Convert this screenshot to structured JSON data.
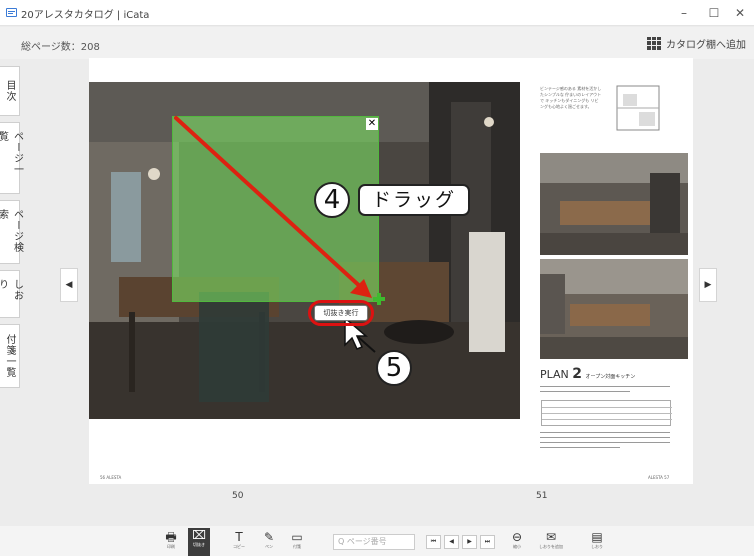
{
  "window": {
    "title": "20アレスタカタログ | iCata",
    "minimize": "–",
    "maximize": "☐",
    "close": "✕"
  },
  "header": {
    "page_count": "総ページ数：208",
    "add_catalog": "カタログ棚へ追加"
  },
  "sidebar": {
    "tabs": [
      "目次",
      "ページ一覧",
      "ページ検索",
      "しおり",
      "付箋一覧"
    ]
  },
  "viewer": {
    "prev_arrow": "◀",
    "next_arrow": "▶",
    "left_page_number": "50",
    "right_page_number": "51",
    "selection_close": "✕",
    "execute_crop_label": "切抜き実行",
    "callout_4_number": "4",
    "callout_4_label": "ドラッグ",
    "callout_5_number": "5",
    "left_footer_text": "56 ALESTA",
    "right_footer_text": "ALESTA 57",
    "right_intro_text": "ビンテージ感のある 素材を活かしたシンプルな 佇まいのレイアウトで キッチンもダイニングも リビングも心地よく過ごせます。",
    "plan_label": "PLAN",
    "plan_number": "2",
    "plan_desc": "オープン対面キッチン"
  },
  "toolbar": {
    "items": [
      {
        "icon": "🖶",
        "label": "印刷"
      },
      {
        "icon": "⌧",
        "label": "切抜き"
      },
      {
        "icon": "T",
        "label": "コピー"
      },
      {
        "icon": "✎",
        "label": "ペン"
      },
      {
        "icon": "▭",
        "label": "付箋"
      }
    ],
    "search_placeholder": "Q ページ番号",
    "nav": [
      "⏮",
      "◀",
      "▶",
      "⏭"
    ],
    "right_items": [
      {
        "icon": "⊖",
        "label": "縮小"
      },
      {
        "icon": "✉",
        "label": "しおりを追加"
      },
      {
        "icon": "▤",
        "label": "しおり"
      }
    ]
  }
}
